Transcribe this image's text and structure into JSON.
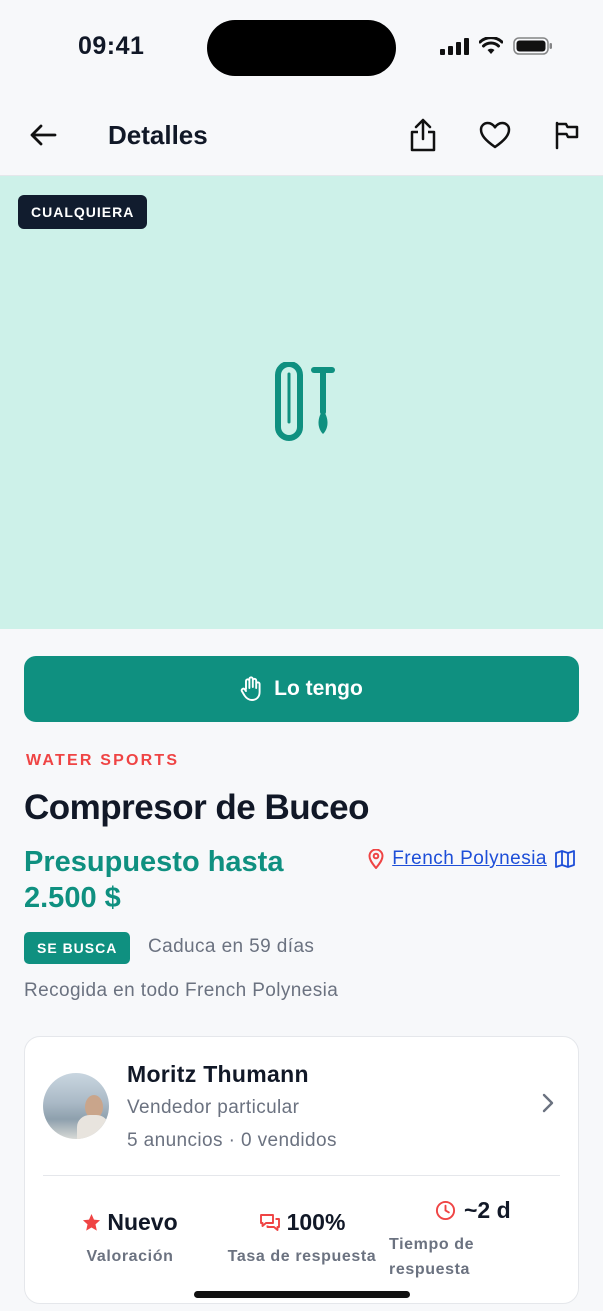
{
  "status_bar": {
    "time": "09:41"
  },
  "header": {
    "title": "Detalles"
  },
  "hero": {
    "condition_badge": "CUALQUIERA",
    "background": "#cdf1e9"
  },
  "cta": {
    "label": "Lo tengo"
  },
  "listing": {
    "category": "WATER SPORTS",
    "title": "Compresor de Buceo",
    "budget": "Presupuesto hasta 2.500 $",
    "location": "French Polynesia",
    "wanted_badge": "SE BUSCA",
    "expires": "Caduca en 59 días",
    "pickup": "Recogida en todo French Polynesia"
  },
  "seller": {
    "name": "Moritz Thumann",
    "type": "Vendedor particular",
    "stats": "5 anuncios · 0 vendidos",
    "metrics": [
      {
        "icon": "star-icon",
        "value": "Nuevo",
        "label": "Valoración"
      },
      {
        "icon": "chat-bubbles-icon",
        "value": "100%",
        "label": "Tasa de respuesta"
      },
      {
        "icon": "clock-icon",
        "value": "~2 d",
        "label": "Tiempo de respuesta"
      }
    ]
  },
  "colors": {
    "accent": "#0f9080",
    "category": "#ef4444",
    "link": "#1d4ed8",
    "badge_dark": "#111c2e"
  }
}
